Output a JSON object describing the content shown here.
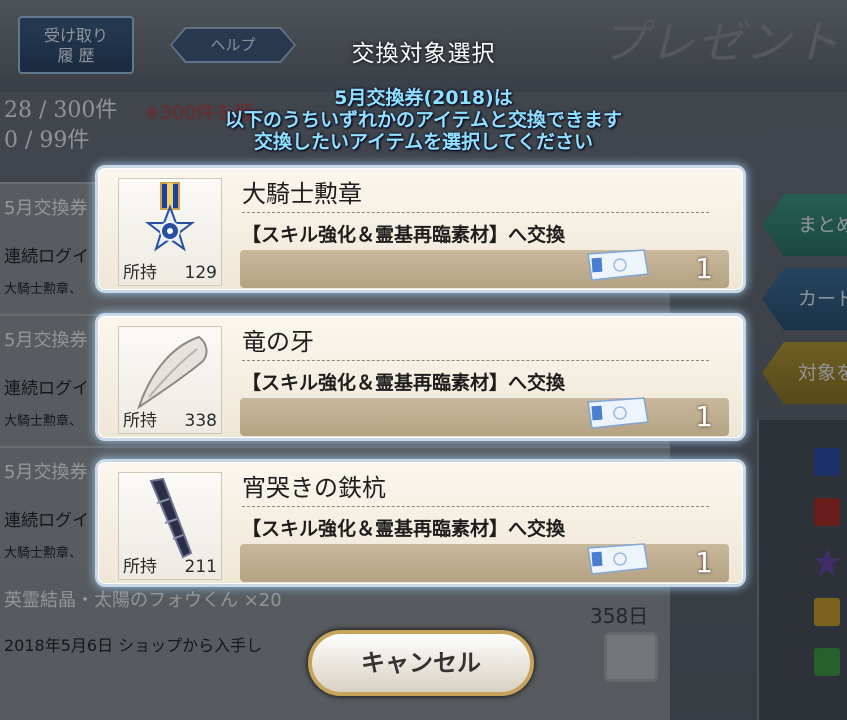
{
  "header": {
    "history_button": "受け取り\n履 歴",
    "history_line1": "受け取り",
    "history_line2": "履 歴",
    "help_button": "ヘルプ",
    "bg_title": "プレゼント",
    "dialog_title": "交換対象選択"
  },
  "background": {
    "count_total": "28 / 300件",
    "count_other": "0 /  99件",
    "warning": "※300件を超",
    "list": [
      {
        "title": "5月交換券",
        "desc": "連続ログイ",
        "sub": "大騎士勲章、"
      },
      {
        "title": "5月交換券",
        "desc": "連続ログイ",
        "sub": "大騎士勲章、"
      },
      {
        "title": "5月交換券",
        "desc": "連続ログイ",
        "sub": "大騎士勲章、"
      }
    ],
    "bottom_title": "英霊結晶・太陽のフォウくん ×20",
    "bottom_desc": "2018年5月6日 ショップから入手し",
    "bottom_days": "358日",
    "side_tabs": [
      "まとめ",
      "カード",
      "対象を"
    ]
  },
  "message": {
    "line1": "5月交換券(2018)は",
    "line2": "以下のうちいずれかのアイテムと交換できます",
    "line3": "交換したいアイテムを選択してください"
  },
  "items": [
    {
      "name": "大騎士勲章",
      "target": "【スキル強化＆霊基再臨素材】へ交換",
      "owned_label": "所持",
      "owned": "129",
      "qty": "1",
      "icon": "medal-icon"
    },
    {
      "name": "竜の牙",
      "target": "【スキル強化＆霊基再臨素材】へ交換",
      "owned_label": "所持",
      "owned": "338",
      "qty": "1",
      "icon": "dragon-fang-icon"
    },
    {
      "name": "宵哭きの鉄杭",
      "target": "【スキル強化＆霊基再臨素材】へ交換",
      "owned_label": "所持",
      "owned": "211",
      "qty": "1",
      "icon": "iron-stake-icon"
    }
  ],
  "cancel_button": "キャンセル",
  "colors": {
    "message": "#8fe2ff",
    "card_glow": "#9ec7ee",
    "cancel_border": "#c7a25a"
  }
}
